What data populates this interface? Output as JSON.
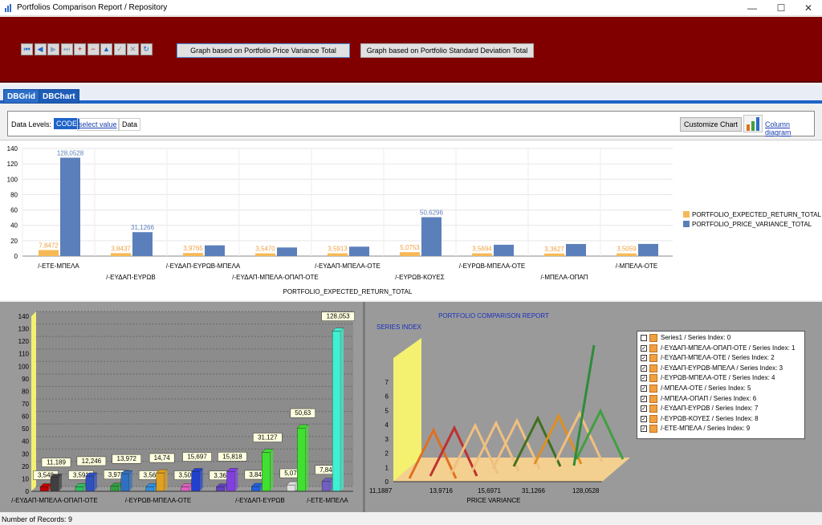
{
  "window": {
    "title": "Portfolios Comparison Report / Repository"
  },
  "toolbar": {
    "nav": [
      "⏮",
      "◀",
      "▶",
      "⏭",
      "+",
      "−",
      "▲",
      "✓",
      "✕",
      "↻"
    ],
    "btn_variance": "Graph based on Portfolio Price Variance Total",
    "btn_stddev": "Graph based on Portfolio Standard Deviation Total"
  },
  "tabs": [
    "DBGrid",
    "DBChart"
  ],
  "datalevels": {
    "label": "Data Levels:",
    "code": "CODE",
    "select": "select value",
    "data": "Data",
    "customize": "Customize Chart",
    "column": "Column diagram"
  },
  "chart_data": [
    {
      "type": "bar",
      "xlabel": "PORTFOLIO_EXPECTED_RETURN_TOTAL",
      "ylim": [
        0,
        140
      ],
      "yticks": [
        "0",
        "20",
        "40",
        "60",
        "80",
        "100",
        "120",
        "140"
      ],
      "categories": [
        "/-ΕΤΕ-ΜΠΕΛΑ",
        "/-ΕΥΔΑΠ-ΕΥΡΩΒ",
        "/-ΕΥΔΑΠ-ΕΥΡΩΒ-ΜΠΕΛΑ",
        "/-ΕΥΔΑΠ-ΜΠΕΛΑ-ΟΠΑΠ-ΟΤΕ",
        "/-ΕΥΔΑΠ-ΜΠΕΛΑ-ΟΤΕ",
        "/-ΕΥΡΩΒ-ΚΟΥΕΣ",
        "/-ΕΥΡΩΒ-ΜΠΕΛΑ-ΟΤΕ",
        "/-ΜΠΕΛΑ-ΟΠΑΠ",
        "/-ΜΠΕΛΑ-ΟΤΕ"
      ],
      "series": [
        {
          "name": "PORTFOLIO_EXPECTED_RETURN_TOTAL",
          "color": "#f7b955",
          "values": [
            7.8472,
            3.8437,
            3.9765,
            3.547,
            3.5913,
            5.0753,
            3.5694,
            3.3627,
            3.5059
          ],
          "labels": [
            "7,8472",
            "3,8437",
            "3,9765",
            "3,5470",
            "3,5913",
            "5,0753",
            "3,5694",
            "3,3627",
            "3,5059"
          ]
        },
        {
          "name": "PORTFOLIO_PRICE_VARIANCE_TOTAL",
          "color": "#5b7fba",
          "values": [
            128.0528,
            31.1266,
            13.97,
            11.19,
            12.25,
            50.6296,
            14.74,
            15.7,
            15.82
          ],
          "labels": [
            "128,0528",
            "31,1266",
            "",
            "",
            "",
            "50,6296",
            "",
            "",
            ""
          ]
        }
      ]
    },
    {
      "type": "bar",
      "ylim": [
        0,
        140
      ],
      "yticks": [
        "0",
        "10",
        "20",
        "30",
        "40",
        "50",
        "60",
        "70",
        "80",
        "90",
        "100",
        "110",
        "120",
        "130",
        "140"
      ],
      "xticklabels": [
        "/-ΕΥΔΑΠ-ΜΠΕΛΑ-ΟΠΑΠ-ΟΤΕ",
        "/-ΕΥΡΩΒ-ΜΠΕΛΑ-ΟΤΕ",
        "/-ΕΥΔΑΠ-ΕΥΡΩΒ",
        "/-ΕΤΕ-ΜΠΕΛΑ"
      ],
      "groups": [
        {
          "a": 3.548,
          "b": 11.189,
          "la": "3,548",
          "lb": "11,189",
          "ca": "#c00000",
          "cb": "#404040"
        },
        {
          "a": 3.591,
          "b": 12.246,
          "la": "3,591",
          "lb": "12,246",
          "ca": "#30c060",
          "cb": "#3050c0"
        },
        {
          "a": 3.977,
          "b": 13.972,
          "la": "3,977",
          "lb": "13,972",
          "ca": "#30a040",
          "cb": "#3070c0"
        },
        {
          "a": 3.569,
          "b": 14.74,
          "la": "3,569",
          "lb": "14,74",
          "ca": "#3090e0",
          "cb": "#e0a020"
        },
        {
          "a": 3.506,
          "b": 15.697,
          "la": "3,506",
          "lb": "15,697",
          "ca": "#e060c0",
          "cb": "#2040d0"
        },
        {
          "a": 3.363,
          "b": 15.818,
          "la": "3,363",
          "lb": "15,818",
          "ca": "#6040c0",
          "cb": "#8040e0"
        },
        {
          "a": 3.844,
          "b": 31.127,
          "la": "3,844",
          "lb": "31,127",
          "ca": "#2060e0",
          "cb": "#40e030"
        },
        {
          "a": 5.075,
          "b": 50.63,
          "la": "5,075",
          "lb": "50,63",
          "ca": "#e0e0e0",
          "cb": "#40e030"
        },
        {
          "a": 7.847,
          "b": 128.053,
          "la": "7,847",
          "lb": "128,053",
          "ca": "#7060c0",
          "cb": "#40f0d0"
        }
      ]
    },
    {
      "type": "line",
      "title": "PORTFOLIO COMPARISON REPORT",
      "ylabel": "SERIES INDEX",
      "xlabel": "PRICE VARIANCE",
      "yticks": [
        "0",
        "1",
        "2",
        "3",
        "4",
        "5",
        "6",
        "7"
      ],
      "xticks": [
        "11,1887",
        "13,9716",
        "15,6971",
        "31,1266",
        "128,0528"
      ],
      "legend": [
        {
          "label": "Series1 / Series Index: 0",
          "checked": false
        },
        {
          "label": "/-ΕΥΔΑΠ-ΜΠΕΛΑ-ΟΠΑΠ-ΟΤΕ / Series Index: 1",
          "checked": true
        },
        {
          "label": "/-ΕΥΔΑΠ-ΜΠΕΛΑ-ΟΤΕ / Series Index: 2",
          "checked": true
        },
        {
          "label": "/-ΕΥΔΑΠ-ΕΥΡΩΒ-ΜΠΕΛΑ / Series Index: 3",
          "checked": true
        },
        {
          "label": "/-ΕΥΡΩΒ-ΜΠΕΛΑ-ΟΤΕ / Series Index: 4",
          "checked": true
        },
        {
          "label": "/-ΜΠΕΛΑ-ΟΤΕ / Series Index: 5",
          "checked": true
        },
        {
          "label": "/-ΜΠΕΛΑ-ΟΠΑΠ / Series Index: 6",
          "checked": true
        },
        {
          "label": "/-ΕΥΔΑΠ-ΕΥΡΩΒ / Series Index: 7",
          "checked": true
        },
        {
          "label": "/-ΕΥΡΩΒ-ΚΟΥΕΣ / Series Index: 8",
          "checked": true
        },
        {
          "label": "/-ΕΤΕ-ΜΠΕΛΑ / Series Index: 9",
          "checked": true
        }
      ]
    }
  ],
  "status": "Number of Records: 9"
}
